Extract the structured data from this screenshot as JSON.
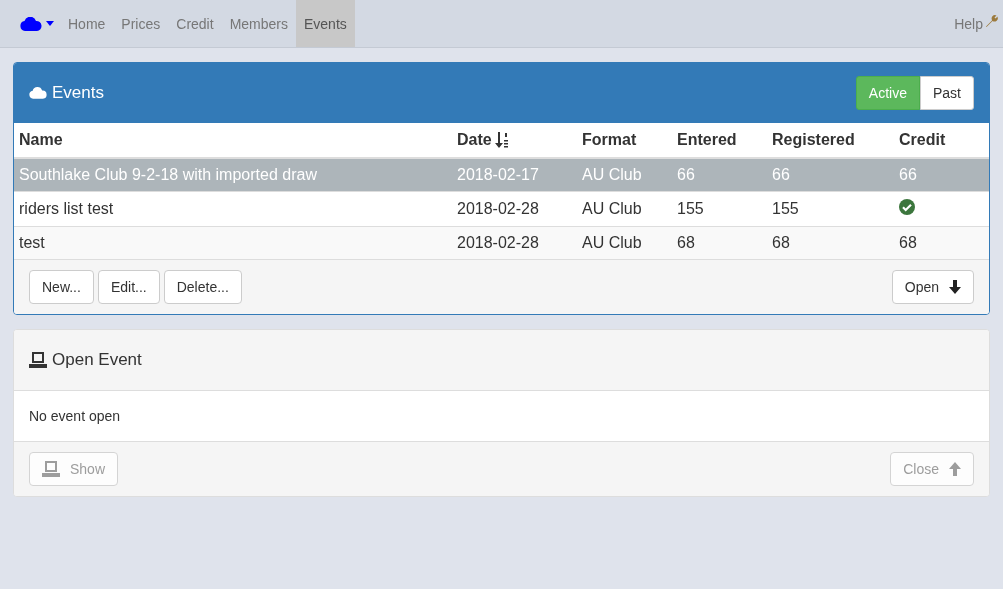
{
  "nav": {
    "items": [
      {
        "label": "Home",
        "selected": false
      },
      {
        "label": "Prices",
        "selected": false
      },
      {
        "label": "Credit",
        "selected": false
      },
      {
        "label": "Members",
        "selected": false
      },
      {
        "label": "Events",
        "selected": true
      }
    ],
    "help": "Help"
  },
  "events_panel": {
    "title": "Events",
    "filters": [
      {
        "label": "Active",
        "selected": true
      },
      {
        "label": "Past",
        "selected": false
      }
    ],
    "table": {
      "columns": [
        {
          "label": "Name",
          "sorted": false
        },
        {
          "label": "Date",
          "sorted": true
        },
        {
          "label": "Format",
          "sorted": false
        },
        {
          "label": "Entered",
          "sorted": false
        },
        {
          "label": "Registered",
          "sorted": false
        },
        {
          "label": "Credit",
          "sorted": false
        }
      ],
      "rows": [
        {
          "selected": true,
          "name": "Southlake Club 9-2-18 with imported draw",
          "date": "2018-02-17",
          "format": "AU Club",
          "entered": "66",
          "registered": "66",
          "credit": {
            "kind": "text",
            "text": "66"
          }
        },
        {
          "selected": false,
          "name": "riders list test",
          "date": "2018-02-28",
          "format": "AU Club",
          "entered": "155",
          "registered": "155",
          "credit": {
            "kind": "check"
          }
        },
        {
          "selected": false,
          "name": "test",
          "date": "2018-02-28",
          "format": "AU Club",
          "entered": "68",
          "registered": "68",
          "credit": {
            "kind": "text",
            "text": "68"
          }
        }
      ]
    },
    "buttons": [
      {
        "label": "New..."
      },
      {
        "label": "Edit..."
      },
      {
        "label": "Delete..."
      }
    ],
    "open_button": {
      "label": "Open"
    }
  },
  "open_event_panel": {
    "title": "Open Event",
    "message": "No event open",
    "show_button": {
      "label": "Show",
      "disabled": true
    },
    "close_button": {
      "label": "Close",
      "disabled": true
    }
  }
}
